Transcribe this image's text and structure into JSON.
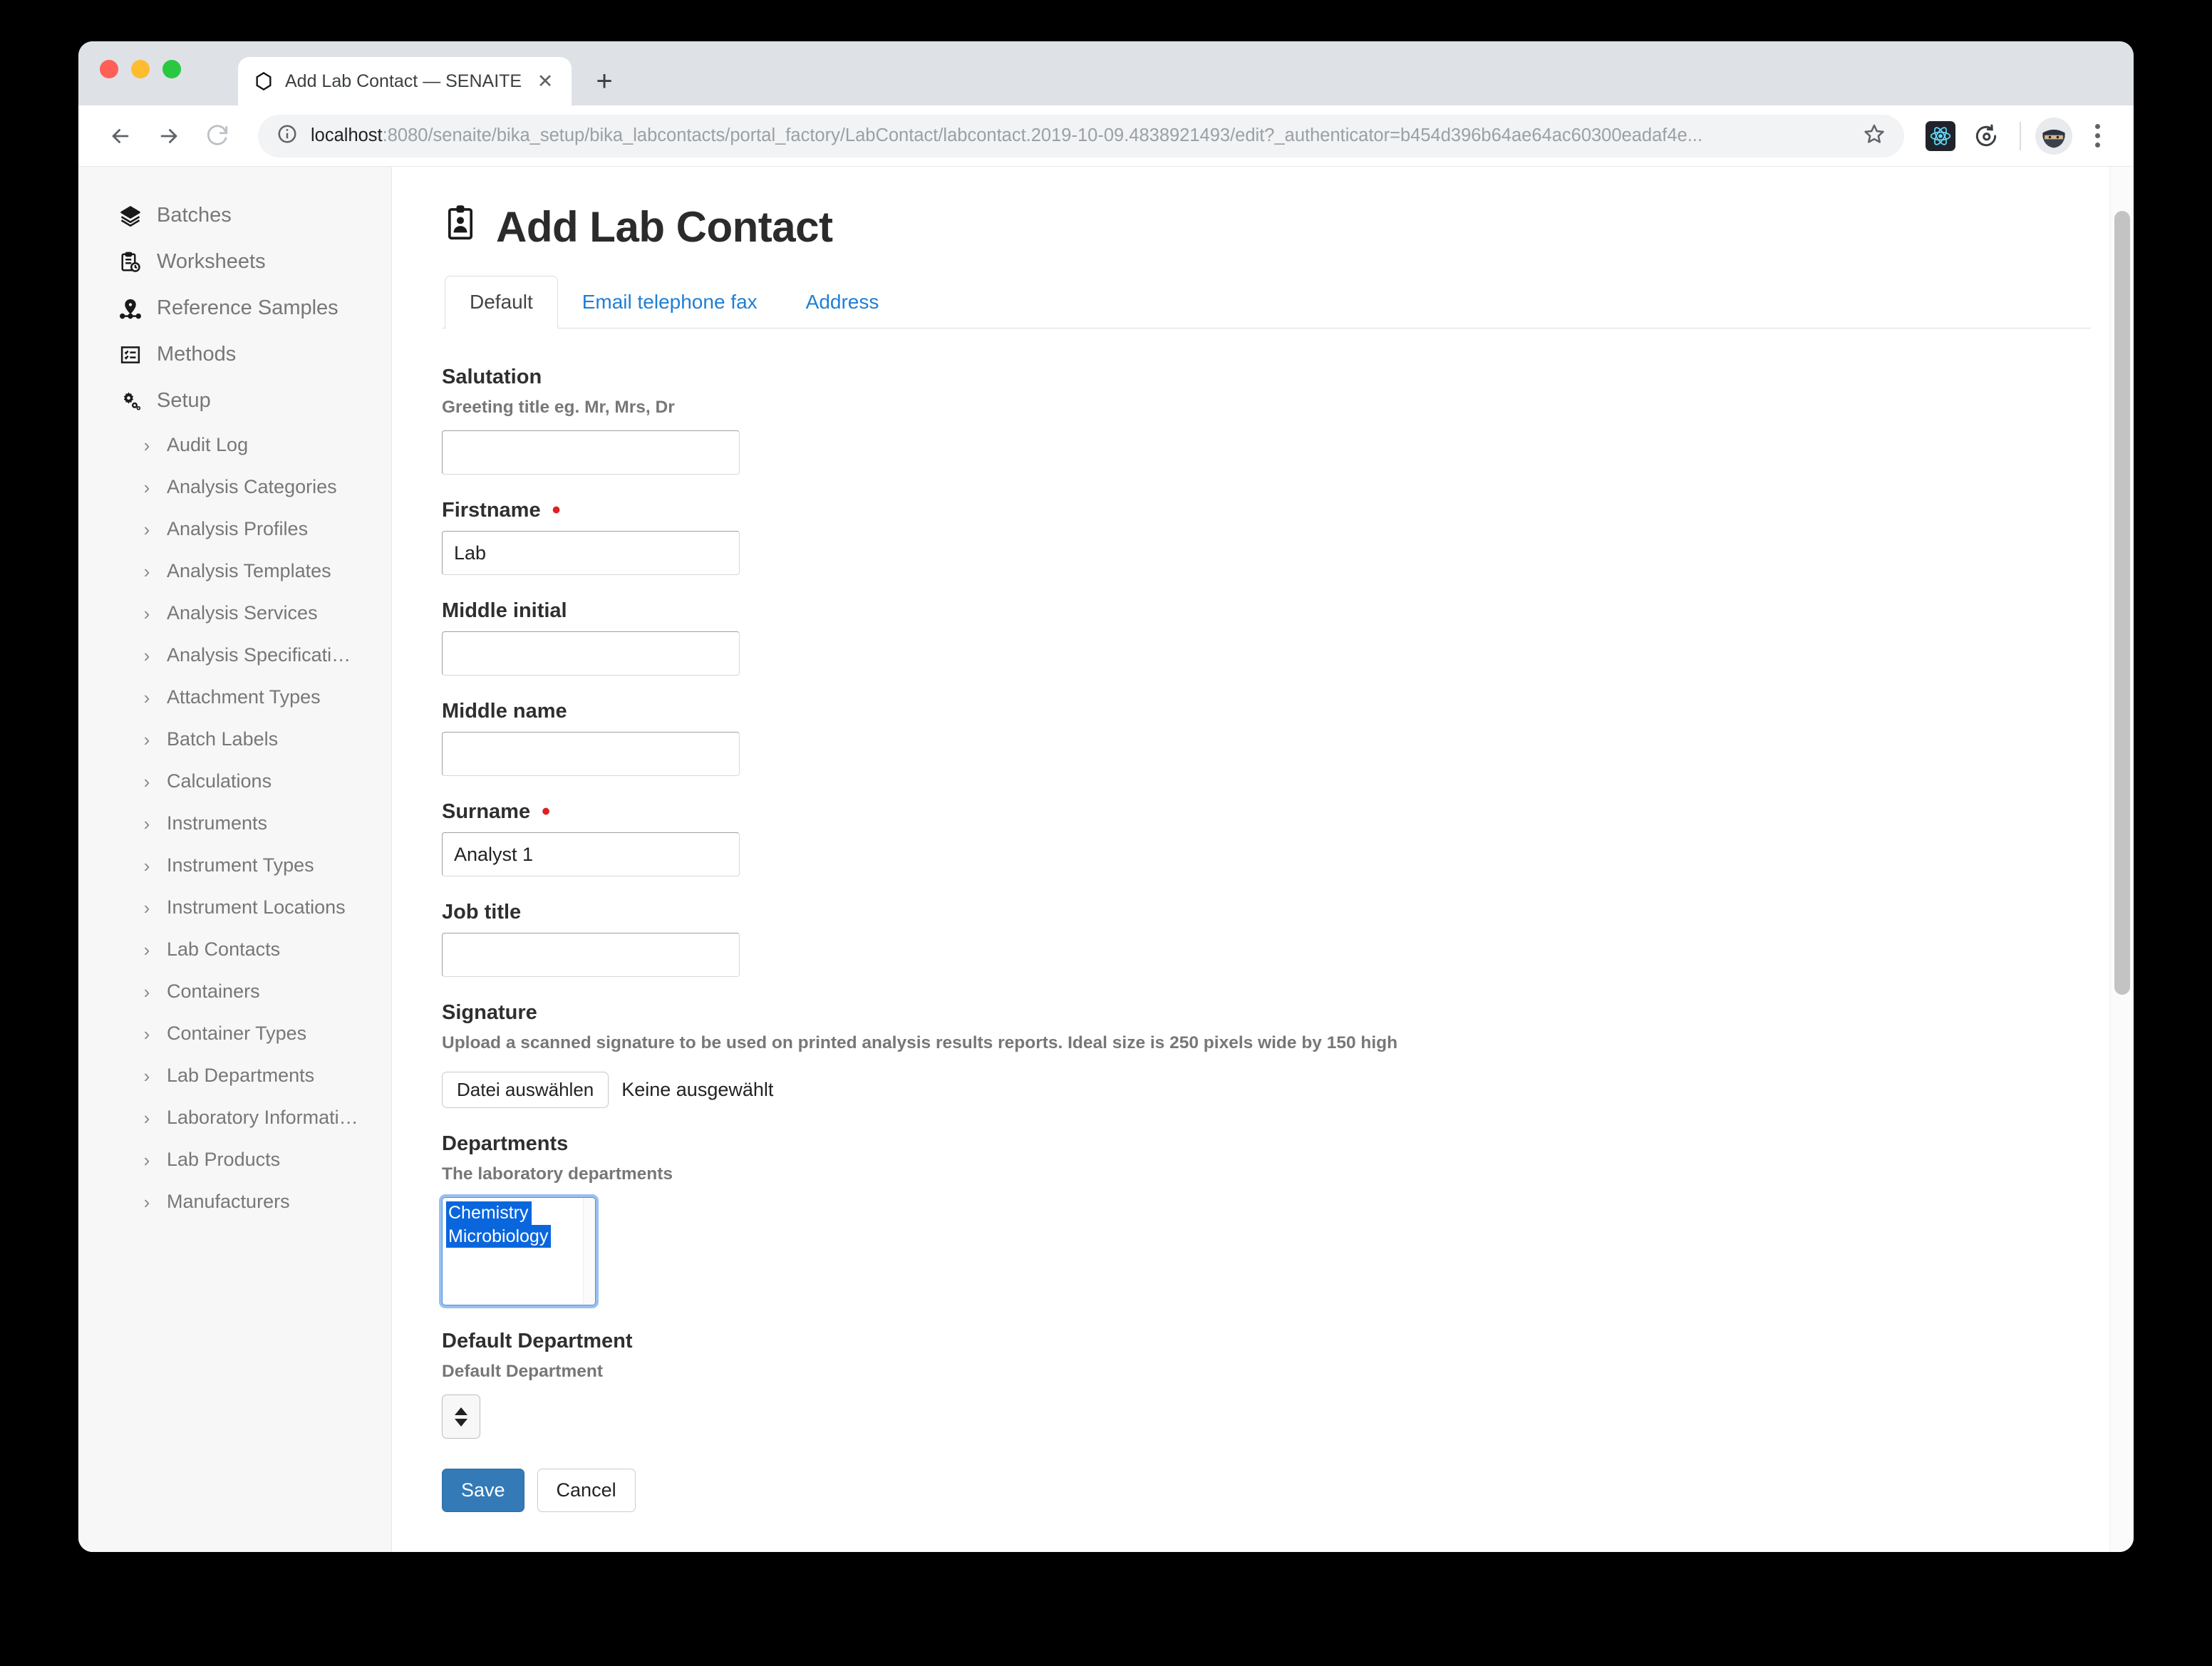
{
  "browser": {
    "tab": {
      "title": "Add Lab Contact — SENAITE",
      "favicon": "senaite-hexagon-icon",
      "close_label": "✕"
    },
    "new_tab_label": "+",
    "nav": {
      "back": "←",
      "forward": "→",
      "reload": "⟳"
    },
    "omnibox": {
      "url_host": "localhost",
      "url_rest": ":8080/senaite/bika_setup/bika_labcontacts/portal_factory/LabContact/labcontact.2019-10-09.4838921493/edit?_authenticator=b454d396b64ae64ac60300eadaf4e...",
      "info_icon": "site-info-icon",
      "star_icon": "bookmark-star-icon"
    },
    "extensions": [
      {
        "name": "react-devtools-icon",
        "glyph": "⚛"
      },
      {
        "name": "refresh-extension-icon",
        "glyph": "⟳"
      }
    ],
    "profile_avatar": "ninja-avatar",
    "menu_icon": "kebab-menu-icon"
  },
  "sidebar": {
    "items": [
      {
        "label": "Batches",
        "icon": "layers-icon"
      },
      {
        "label": "Worksheets",
        "icon": "clipboard-clock-icon"
      },
      {
        "label": "Reference Samples",
        "icon": "map-pin-icon"
      },
      {
        "label": "Methods",
        "icon": "checklist-icon"
      },
      {
        "label": "Setup",
        "icon": "gears-icon"
      }
    ],
    "setup_children": [
      {
        "label": "Audit Log"
      },
      {
        "label": "Analysis Categories"
      },
      {
        "label": "Analysis Profiles"
      },
      {
        "label": "Analysis Templates"
      },
      {
        "label": "Analysis Services"
      },
      {
        "label": "Analysis Specificati…"
      },
      {
        "label": "Attachment Types"
      },
      {
        "label": "Batch Labels"
      },
      {
        "label": "Calculations"
      },
      {
        "label": "Instruments"
      },
      {
        "label": "Instrument Types"
      },
      {
        "label": "Instrument Locations"
      },
      {
        "label": "Lab Contacts"
      },
      {
        "label": "Containers"
      },
      {
        "label": "Container Types"
      },
      {
        "label": "Lab Departments"
      },
      {
        "label": "Laboratory Informati…"
      },
      {
        "label": "Lab Products"
      },
      {
        "label": "Manufacturers"
      }
    ],
    "chevron": "›"
  },
  "page": {
    "title": "Add Lab Contact",
    "title_icon": "contact-card-icon",
    "tabs": [
      {
        "label": "Default",
        "active": true
      },
      {
        "label": "Email telephone fax",
        "active": false
      },
      {
        "label": "Address",
        "active": false
      }
    ]
  },
  "form": {
    "salutation": {
      "label": "Salutation",
      "hint": "Greeting title eg. Mr, Mrs, Dr",
      "value": ""
    },
    "firstname": {
      "label": "Firstname",
      "required_marker": "•",
      "value": "Lab"
    },
    "middle_initial": {
      "label": "Middle initial",
      "value": ""
    },
    "middle_name": {
      "label": "Middle name",
      "value": ""
    },
    "surname": {
      "label": "Surname",
      "required_marker": "•",
      "value": "Analyst 1"
    },
    "job_title": {
      "label": "Job title",
      "value": ""
    },
    "signature": {
      "label": "Signature",
      "hint": "Upload a scanned signature to be used on printed analysis results reports. Ideal size is 250 pixels wide by 150 high",
      "button_label": "Datei auswählen",
      "status": "Keine ausgewählt"
    },
    "departments": {
      "label": "Departments",
      "hint": "The laboratory departments",
      "options": [
        {
          "label": "Chemistry",
          "selected": true
        },
        {
          "label": "Microbiology",
          "selected": true
        }
      ]
    },
    "default_department": {
      "label": "Default Department",
      "hint": "Default Department",
      "value": ""
    },
    "buttons": {
      "save": "Save",
      "cancel": "Cancel"
    }
  },
  "colors": {
    "accent_blue": "#337ab7",
    "link_blue": "#1f7fd4",
    "selection_blue": "#0a66dd",
    "required_red": "#e02020",
    "sidebar_bg": "#f7f7f7"
  }
}
